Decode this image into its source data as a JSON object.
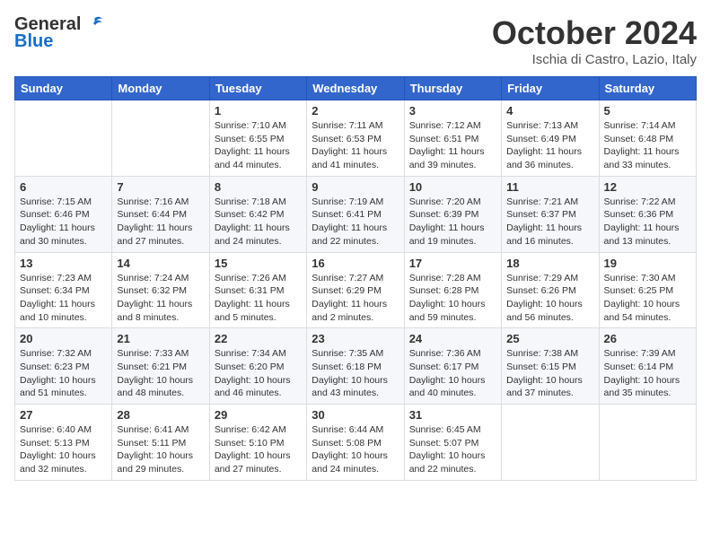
{
  "logo": {
    "general": "General",
    "blue": "Blue"
  },
  "header": {
    "month": "October 2024",
    "location": "Ischia di Castro, Lazio, Italy"
  },
  "weekdays": [
    "Sunday",
    "Monday",
    "Tuesday",
    "Wednesday",
    "Thursday",
    "Friday",
    "Saturday"
  ],
  "weeks": [
    [
      null,
      null,
      {
        "day": 1,
        "sunrise": "7:10 AM",
        "sunset": "6:55 PM",
        "daylight": "11 hours and 44 minutes."
      },
      {
        "day": 2,
        "sunrise": "7:11 AM",
        "sunset": "6:53 PM",
        "daylight": "11 hours and 41 minutes."
      },
      {
        "day": 3,
        "sunrise": "7:12 AM",
        "sunset": "6:51 PM",
        "daylight": "11 hours and 39 minutes."
      },
      {
        "day": 4,
        "sunrise": "7:13 AM",
        "sunset": "6:49 PM",
        "daylight": "11 hours and 36 minutes."
      },
      {
        "day": 5,
        "sunrise": "7:14 AM",
        "sunset": "6:48 PM",
        "daylight": "11 hours and 33 minutes."
      }
    ],
    [
      {
        "day": 6,
        "sunrise": "7:15 AM",
        "sunset": "6:46 PM",
        "daylight": "11 hours and 30 minutes."
      },
      {
        "day": 7,
        "sunrise": "7:16 AM",
        "sunset": "6:44 PM",
        "daylight": "11 hours and 27 minutes."
      },
      {
        "day": 8,
        "sunrise": "7:18 AM",
        "sunset": "6:42 PM",
        "daylight": "11 hours and 24 minutes."
      },
      {
        "day": 9,
        "sunrise": "7:19 AM",
        "sunset": "6:41 PM",
        "daylight": "11 hours and 22 minutes."
      },
      {
        "day": 10,
        "sunrise": "7:20 AM",
        "sunset": "6:39 PM",
        "daylight": "11 hours and 19 minutes."
      },
      {
        "day": 11,
        "sunrise": "7:21 AM",
        "sunset": "6:37 PM",
        "daylight": "11 hours and 16 minutes."
      },
      {
        "day": 12,
        "sunrise": "7:22 AM",
        "sunset": "6:36 PM",
        "daylight": "11 hours and 13 minutes."
      }
    ],
    [
      {
        "day": 13,
        "sunrise": "7:23 AM",
        "sunset": "6:34 PM",
        "daylight": "11 hours and 10 minutes."
      },
      {
        "day": 14,
        "sunrise": "7:24 AM",
        "sunset": "6:32 PM",
        "daylight": "11 hours and 8 minutes."
      },
      {
        "day": 15,
        "sunrise": "7:26 AM",
        "sunset": "6:31 PM",
        "daylight": "11 hours and 5 minutes."
      },
      {
        "day": 16,
        "sunrise": "7:27 AM",
        "sunset": "6:29 PM",
        "daylight": "11 hours and 2 minutes."
      },
      {
        "day": 17,
        "sunrise": "7:28 AM",
        "sunset": "6:28 PM",
        "daylight": "10 hours and 59 minutes."
      },
      {
        "day": 18,
        "sunrise": "7:29 AM",
        "sunset": "6:26 PM",
        "daylight": "10 hours and 56 minutes."
      },
      {
        "day": 19,
        "sunrise": "7:30 AM",
        "sunset": "6:25 PM",
        "daylight": "10 hours and 54 minutes."
      }
    ],
    [
      {
        "day": 20,
        "sunrise": "7:32 AM",
        "sunset": "6:23 PM",
        "daylight": "10 hours and 51 minutes."
      },
      {
        "day": 21,
        "sunrise": "7:33 AM",
        "sunset": "6:21 PM",
        "daylight": "10 hours and 48 minutes."
      },
      {
        "day": 22,
        "sunrise": "7:34 AM",
        "sunset": "6:20 PM",
        "daylight": "10 hours and 46 minutes."
      },
      {
        "day": 23,
        "sunrise": "7:35 AM",
        "sunset": "6:18 PM",
        "daylight": "10 hours and 43 minutes."
      },
      {
        "day": 24,
        "sunrise": "7:36 AM",
        "sunset": "6:17 PM",
        "daylight": "10 hours and 40 minutes."
      },
      {
        "day": 25,
        "sunrise": "7:38 AM",
        "sunset": "6:15 PM",
        "daylight": "10 hours and 37 minutes."
      },
      {
        "day": 26,
        "sunrise": "7:39 AM",
        "sunset": "6:14 PM",
        "daylight": "10 hours and 35 minutes."
      }
    ],
    [
      {
        "day": 27,
        "sunrise": "6:40 AM",
        "sunset": "5:13 PM",
        "daylight": "10 hours and 32 minutes."
      },
      {
        "day": 28,
        "sunrise": "6:41 AM",
        "sunset": "5:11 PM",
        "daylight": "10 hours and 29 minutes."
      },
      {
        "day": 29,
        "sunrise": "6:42 AM",
        "sunset": "5:10 PM",
        "daylight": "10 hours and 27 minutes."
      },
      {
        "day": 30,
        "sunrise": "6:44 AM",
        "sunset": "5:08 PM",
        "daylight": "10 hours and 24 minutes."
      },
      {
        "day": 31,
        "sunrise": "6:45 AM",
        "sunset": "5:07 PM",
        "daylight": "10 hours and 22 minutes."
      },
      null,
      null
    ]
  ]
}
